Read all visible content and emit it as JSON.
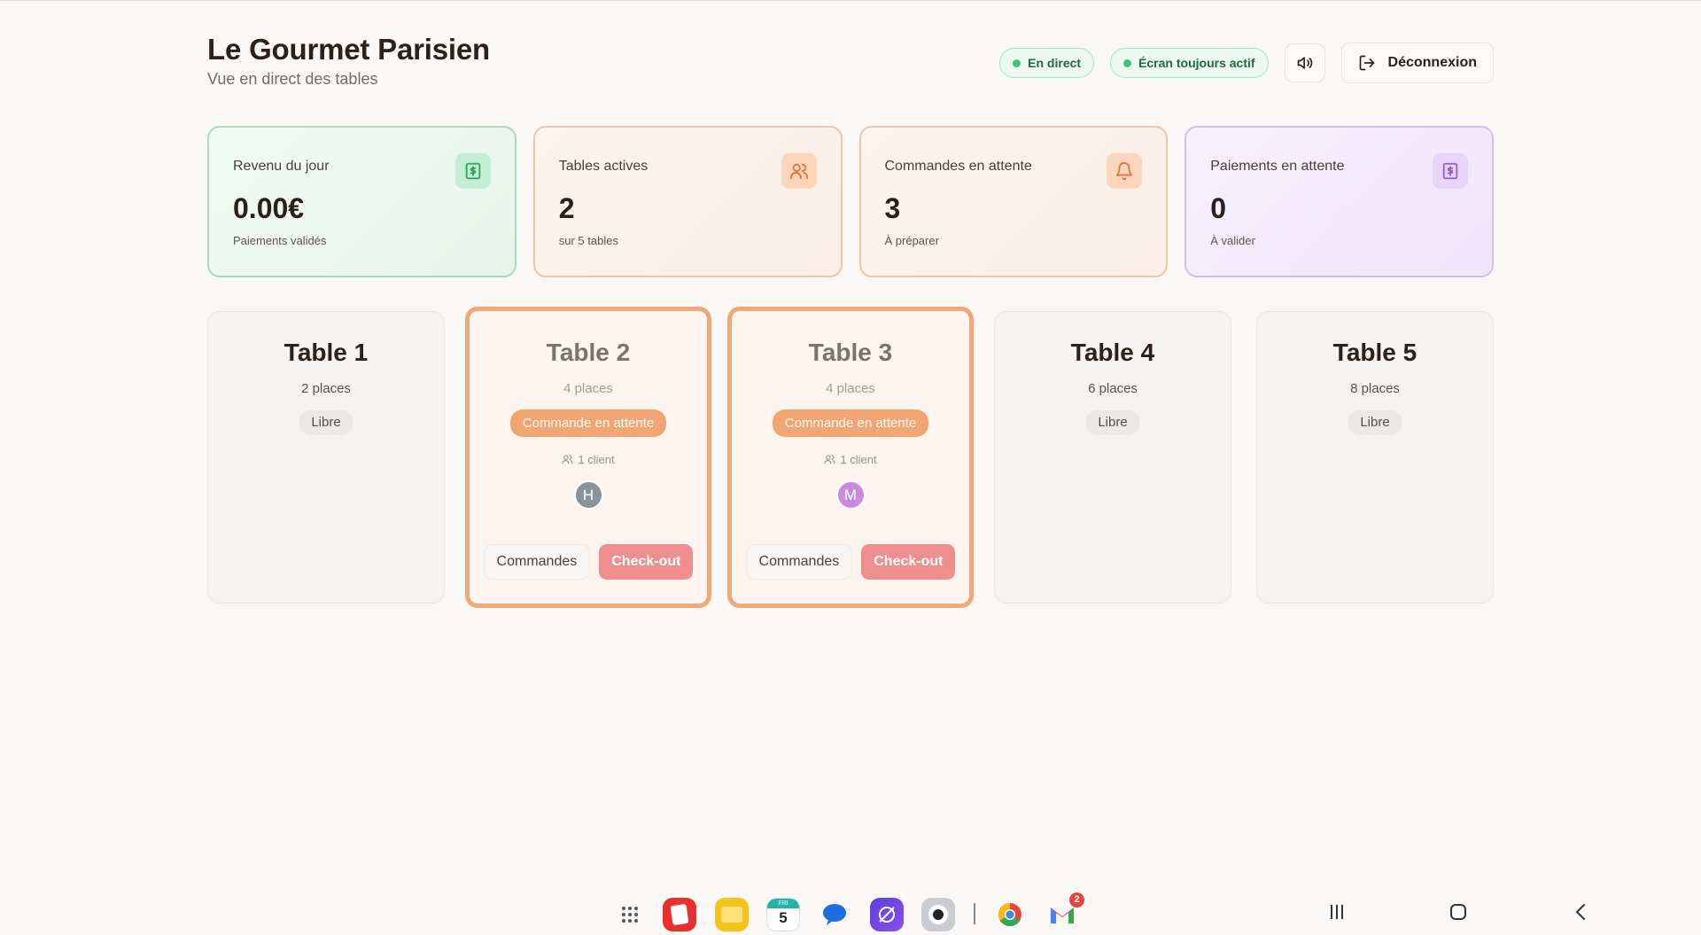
{
  "header": {
    "title": "Le Gourmet Parisien",
    "subtitle": "Vue en direct des tables",
    "live_label": "En direct",
    "screen_label": "Écran toujours actif",
    "logout_label": "Déconnexion"
  },
  "stats": [
    {
      "label": "Revenu du jour",
      "value": "0.00€",
      "sub": "Paiements validés",
      "icon": "dollar-bill-icon",
      "color": "#2fa55f"
    },
    {
      "label": "Tables actives",
      "value": "2",
      "sub": "sur 5 tables",
      "icon": "users-icon",
      "color": "#e0753d"
    },
    {
      "label": "Commandes en attente",
      "value": "3",
      "sub": "À préparer",
      "icon": "bell-icon",
      "color": "#e0753d"
    },
    {
      "label": "Paiements en attente",
      "value": "0",
      "sub": "À valider",
      "icon": "dollar-bill-icon",
      "color": "#9a5ae0"
    }
  ],
  "tables": [
    {
      "name": "Table 1",
      "places": "2 places",
      "status": "Libre"
    },
    {
      "name": "Table 2",
      "places": "4 places",
      "status": "Commande en attente",
      "clients": "1 client",
      "avatar": "H",
      "avatar_color": "#8b9298",
      "orders_label": "Commandes",
      "checkout_label": "Check-out"
    },
    {
      "name": "Table 3",
      "places": "4 places",
      "status": "Commande en attente",
      "clients": "1 client",
      "avatar": "M",
      "avatar_color": "#c98be0",
      "orders_label": "Commandes",
      "checkout_label": "Check-out"
    },
    {
      "name": "Table 4",
      "places": "6 places",
      "status": "Libre"
    },
    {
      "name": "Table 5",
      "places": "8 places",
      "status": "Libre"
    }
  ],
  "taskbar": {
    "calendar_day": "5",
    "calendar_weekday": "FRI",
    "gmail_badge": "2",
    "apps": [
      "app-grid-icon",
      "notes-app-icon",
      "files-app-icon",
      "calendar-app-icon",
      "messages-app-icon",
      "internet-app-icon",
      "camera-app-icon",
      "chrome-app-icon",
      "gmail-app-icon"
    ]
  }
}
